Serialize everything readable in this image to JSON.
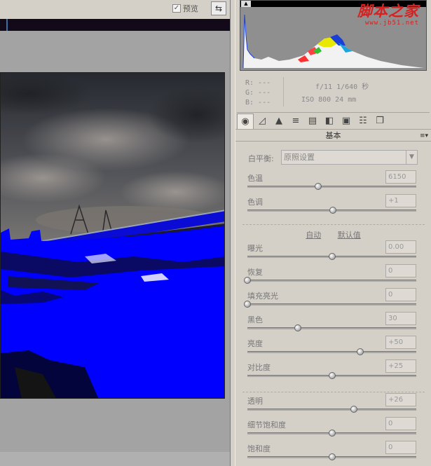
{
  "preview": {
    "label": "预览",
    "checked_glyph": "✓"
  },
  "toggle_icon": "fullscreen-toggle-icon",
  "watermark": {
    "cn": "脚本之家",
    "url": "www.jb51.net"
  },
  "readout": {
    "r": "R:  ---",
    "g": "G:  ---",
    "b": "B:  ---",
    "exposure": "f/11   1/640 秒",
    "iso": "ISO 800   24 mm"
  },
  "toolbar": {
    "icons": [
      "basic-aperture-icon",
      "tone-curve-icon",
      "detail-icon",
      "hsl-icon",
      "split-toning-icon",
      "lens-corrections-icon",
      "effects-icon",
      "camera-calibration-icon",
      "presets-icon"
    ],
    "glyphs": [
      "◉",
      "◿",
      "▲",
      "≡",
      "▤",
      "◧",
      "▣",
      "☷",
      "❐"
    ]
  },
  "panel": {
    "title": "基本",
    "menu_glyph": "≡▾"
  },
  "white_balance": {
    "label": "白平衡:",
    "value": "原照设置"
  },
  "auto_link": "自动",
  "default_link": "默认值",
  "sliders": [
    {
      "label": "色温",
      "value": "6150",
      "level": 0.42
    },
    {
      "label": "色调",
      "value": "+1",
      "level": 0.505
    },
    {
      "label": "曝光",
      "value": "0.00",
      "level": 0.5
    },
    {
      "label": "恢复",
      "value": "0",
      "level": 0.0
    },
    {
      "label": "填充亮光",
      "value": "0",
      "level": 0.0
    },
    {
      "label": "黑色",
      "value": "30",
      "level": 0.3
    },
    {
      "label": "亮度",
      "value": "+50",
      "level": 0.67
    },
    {
      "label": "对比度",
      "value": "+25",
      "level": 0.5
    },
    {
      "label": "透明",
      "value": "+26",
      "level": 0.63
    },
    {
      "label": "细节饱和度",
      "value": "0",
      "level": 0.5
    },
    {
      "label": "饱和度",
      "value": "0",
      "level": 0.5
    }
  ],
  "colors": {
    "clip_warning": "#0000ff",
    "watermark": "#d72020",
    "panel_bg": "#d4d0c8"
  }
}
